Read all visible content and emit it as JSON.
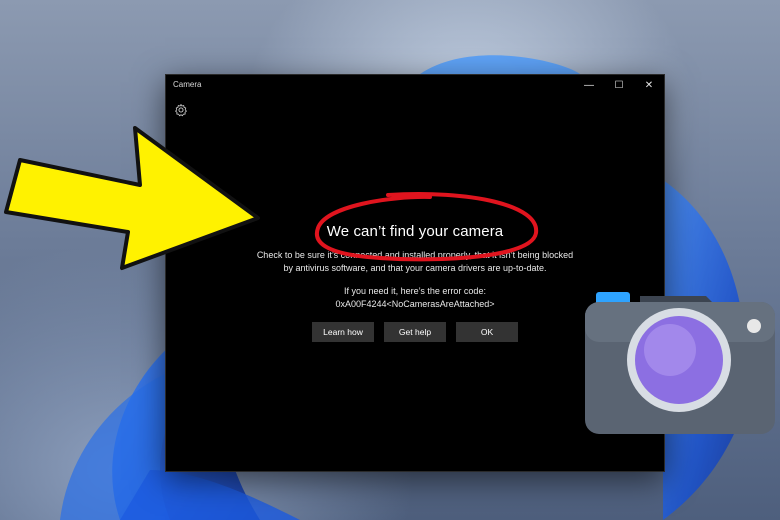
{
  "window": {
    "title": "Camera",
    "controls": {
      "minimize": "—",
      "maximize": "☐",
      "close": "✕"
    }
  },
  "error": {
    "heading": "We can’t find your camera",
    "description_line1": "Check to be sure it’s connected and installed properly, that it isn’t being blocked",
    "description_line2": "by antivirus software, and that your camera drivers are up-to-date.",
    "error_intro": "If you need it, here’s the error code:",
    "error_code": "0xA00F4244<NoCamerasAreAttached>"
  },
  "buttons": {
    "learn_how": "Learn how",
    "get_help": "Get help",
    "ok": "OK"
  },
  "colors": {
    "arrow": "#fff200",
    "circle": "#e0141e",
    "window_bg": "#000000",
    "button_bg": "#333333",
    "camera_body": "#5a6472",
    "camera_lens": "#9b7fe0"
  },
  "icons": [
    "settings-gear-icon",
    "yellow-arrow",
    "red-circle-annotation",
    "camera-app-icon"
  ]
}
